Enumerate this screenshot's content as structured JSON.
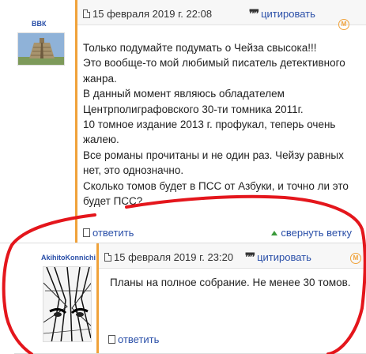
{
  "posts": [
    {
      "author": "ВВК",
      "date": "15 февраля 2019 г. 22:08",
      "quote_label": "цитировать",
      "body_lines": [
        "Только подумайте подумать о Чейза свысока!!!",
        "Это вообще-то мой любимый писатель детективного",
        "жанра.",
        "В данный момент являюсь обладателем",
        "Центрполиграфовского 30-ти томника 2011г.",
        "10 томное издание 2013 г. профукал, теперь очень",
        "жалею.",
        "Все романы прочитаны и не один раз. Чейзу равных",
        "нет, это однозначно.",
        "Сколько томов будет в ПСС от Азбуки, и точно ли это",
        "будет ПСС?"
      ],
      "reply_label": "ответить",
      "collapse_label": "свернуть ветку"
    },
    {
      "author": "AkihitoKonnichi",
      "date": "15 февраля 2019 г. 23:20",
      "quote_label": "цитировать",
      "body_lines": [
        "Планы на полное собрание. Не менее 30 томов."
      ],
      "reply_label": "ответить"
    }
  ],
  "icons": {
    "date": "document-icon",
    "quote": "quote-icon",
    "report": "report-flag-icon",
    "reply": "reply-icon",
    "collapse": "triangle-up-icon"
  },
  "colors": {
    "link": "#2a4fa8",
    "accent": "#f0a23a",
    "annotation": "#e4161c"
  }
}
